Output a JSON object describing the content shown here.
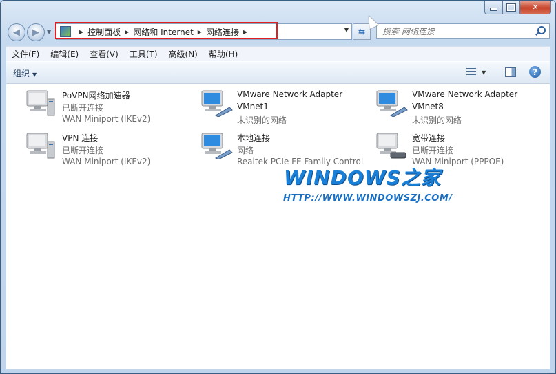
{
  "breadcrumb": {
    "items": [
      "控制面板",
      "网络和 Internet",
      "网络连接"
    ]
  },
  "search": {
    "placeholder": "搜索 网络连接"
  },
  "menu": [
    "文件(F)",
    "编辑(E)",
    "查看(V)",
    "工具(T)",
    "高级(N)",
    "帮助(H)"
  ],
  "commandbar": {
    "organize_label": "组织"
  },
  "connections": [
    {
      "name": "PoVPN网络加速器",
      "status": "已断开连接",
      "device": "WAN Miniport (IKEv2)",
      "icon": "vpn-connection-icon"
    },
    {
      "name": "VMware Network Adapter VMnet1",
      "name_line1": "VMware Network Adapter",
      "name_line2": "VMnet1",
      "status": "未识别的网络",
      "device": "",
      "icon": "network-adapter-icon"
    },
    {
      "name": "VMware Network Adapter VMnet8",
      "name_line1": "VMware Network Adapter",
      "name_line2": "VMnet8",
      "status": "未识别的网络",
      "device": "",
      "icon": "network-adapter-icon"
    },
    {
      "name": "VPN 连接",
      "status": "已断开连接",
      "device": "WAN Miniport (IKEv2)",
      "icon": "vpn-connection-icon"
    },
    {
      "name": "本地连接",
      "status": "网络",
      "device": "Realtek PCIe FE Family Control",
      "icon": "network-adapter-icon"
    },
    {
      "name": "宽带连接",
      "status": "已断开连接",
      "device": "WAN Miniport (PPPOE)",
      "icon": "broadband-connection-icon"
    }
  ],
  "watermark": {
    "logo_text": "WINDOWS之家",
    "url": "HTTP://WWW.WINDOWSZJ.COM/"
  },
  "colors": {
    "highlight_box": "#e02020",
    "watermark": "#1a7fd6"
  }
}
